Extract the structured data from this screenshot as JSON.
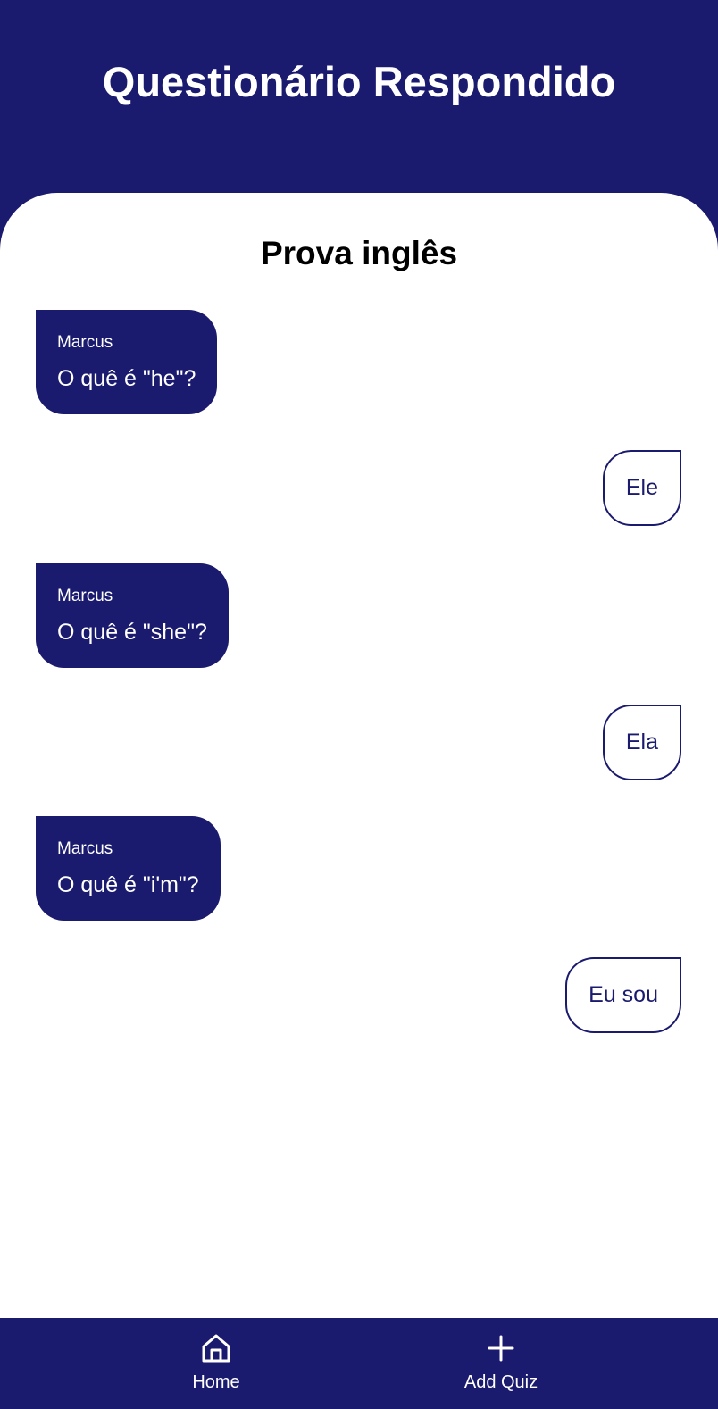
{
  "header": {
    "title": "Questionário Respondido"
  },
  "quiz": {
    "title": "Prova inglês",
    "messages": [
      {
        "author": "Marcus",
        "question": "O quê é \"he\"?",
        "answer": "Ele"
      },
      {
        "author": "Marcus",
        "question": "O quê é \"she\"?",
        "answer": "Ela"
      },
      {
        "author": "Marcus",
        "question": "O quê é \"i'm\"?",
        "answer": "Eu sou"
      }
    ]
  },
  "nav": {
    "items": [
      {
        "label": "Home",
        "icon": "home-icon"
      },
      {
        "label": "Add Quiz",
        "icon": "plus-icon"
      }
    ]
  },
  "colors": {
    "primary": "#1a1a6e",
    "surface": "#ffffff"
  }
}
